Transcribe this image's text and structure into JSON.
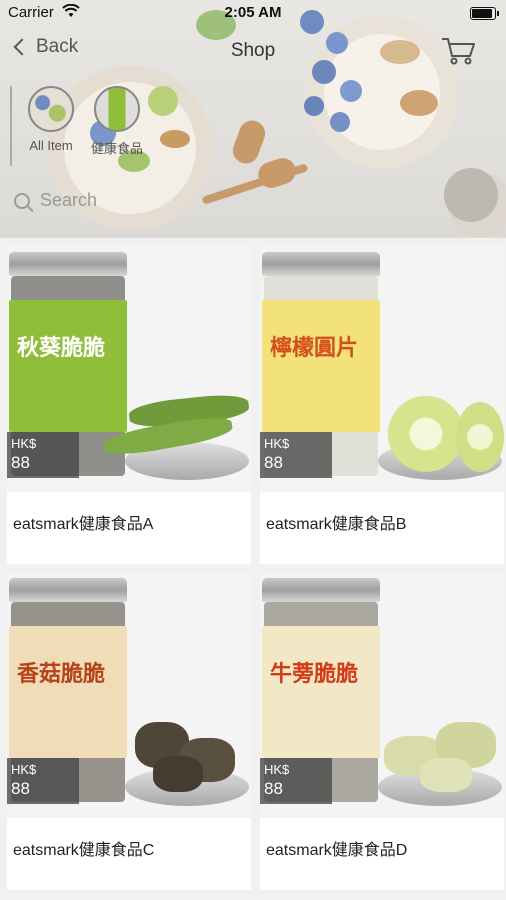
{
  "status": {
    "carrier": "Carrier",
    "time": "2:05 AM"
  },
  "nav": {
    "back_label": "Back",
    "title": "Shop"
  },
  "categories": [
    {
      "label": "All Item"
    },
    {
      "label": "健康食品"
    }
  ],
  "search": {
    "placeholder": "Search"
  },
  "colors": {
    "accent": "#555555",
    "card_bg": "#ffffff",
    "price_tag_bg": "#464646"
  },
  "products": [
    {
      "name": "eatsmark健康食品A",
      "currency": "HK$",
      "price": "88",
      "jar_label": "秋葵脆脆",
      "label_color": "#8fbf3a",
      "text_color": "#ffffff"
    },
    {
      "name": "eatsmark健康食品B",
      "currency": "HK$",
      "price": "88",
      "jar_label": "檸檬圓片",
      "label_color": "#f3e27a",
      "text_color": "#d2501c"
    },
    {
      "name": "eatsmark健康食品C",
      "currency": "HK$",
      "price": "88",
      "jar_label": "香菇脆脆",
      "label_color": "#f0dcb6",
      "text_color": "#b5431a"
    },
    {
      "name": "eatsmark健康食品D",
      "currency": "HK$",
      "price": "88",
      "jar_label": "牛蒡脆脆",
      "label_color": "#f3e8c6",
      "text_color": "#d33a18"
    }
  ]
}
